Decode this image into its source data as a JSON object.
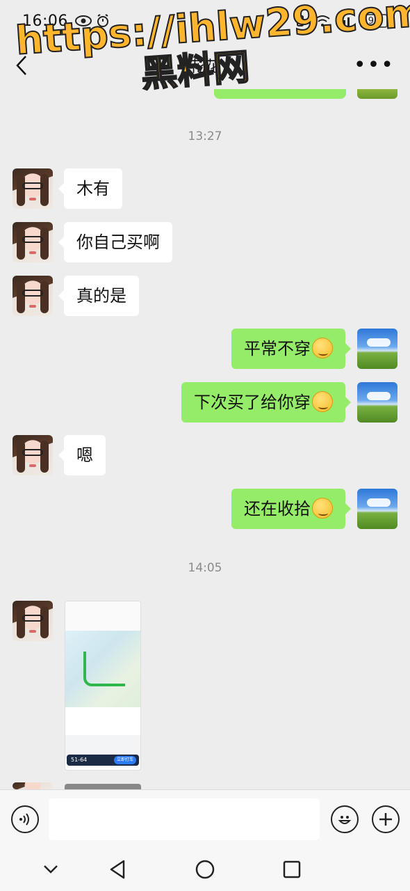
{
  "status_bar": {
    "time": "16:06",
    "battery": "97"
  },
  "header": {
    "title": "花花",
    "back_icon": "chevron-left-icon",
    "more_icon": "more-icon"
  },
  "watermark": {
    "line1": "https://ihlw29.com",
    "line2": "黑料网"
  },
  "messages": [
    {
      "type": "timestamp",
      "text": "13:27"
    },
    {
      "type": "text",
      "side": "left",
      "text": "木有"
    },
    {
      "type": "text",
      "side": "left",
      "text": "你自己买啊"
    },
    {
      "type": "text",
      "side": "left",
      "text": "真的是"
    },
    {
      "type": "text",
      "side": "right",
      "text": "平常不穿",
      "emoji": "shy-face-emoji"
    },
    {
      "type": "text",
      "side": "right",
      "text": "下次买了给你穿",
      "emoji": "wink-face-emoji"
    },
    {
      "type": "text",
      "side": "left",
      "text": "嗯"
    },
    {
      "type": "text",
      "side": "right",
      "text": "还在收拾",
      "emoji": "wink-face-emoji"
    },
    {
      "type": "timestamp",
      "text": "14:05"
    },
    {
      "type": "image",
      "side": "left",
      "description_icon": "map-screenshot-image",
      "bar_price": "51-64",
      "bar_button": "立即打车"
    }
  ],
  "input_bar": {
    "voice_icon": "voice-icon",
    "input_value": "",
    "emoji_icon": "smile-icon",
    "plus_icon": "plus-icon"
  },
  "nav_bar": {
    "icons": [
      "chevron-down-icon",
      "back-triangle-icon",
      "home-circle-icon",
      "recents-square-icon"
    ]
  }
}
